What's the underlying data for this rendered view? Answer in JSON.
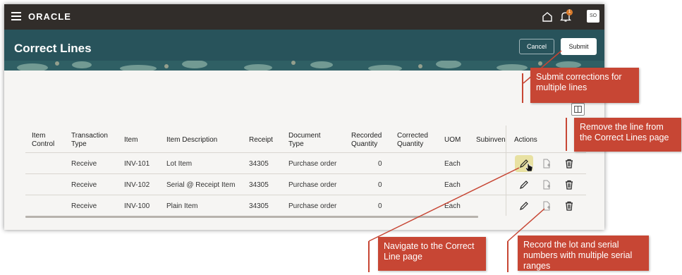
{
  "app": {
    "brand": "ORACLE",
    "notification_count": "1",
    "user_initials": "SO"
  },
  "header": {
    "title": "Correct Lines",
    "cancel_label": "Cancel",
    "submit_label": "Submit"
  },
  "table": {
    "columns": [
      "Item Control",
      "Transaction Type",
      "Item",
      "Item Description",
      "Receipt",
      "Document Type",
      "Recorded Quantity",
      "Corrected Quantity",
      "UOM",
      "Subinven",
      "Actions"
    ],
    "rows": [
      {
        "item_control": "",
        "transaction_type": "Receive",
        "item": "INV-101",
        "item_description": "Lot Item",
        "receipt": "34305",
        "document_type": "Purchase order",
        "recorded_quantity": "0",
        "corrected_quantity": "",
        "uom": "Each",
        "subinventory": ""
      },
      {
        "item_control": "",
        "transaction_type": "Receive",
        "item": "INV-102",
        "item_description": "Serial @ Receipt Item",
        "receipt": "34305",
        "document_type": "Purchase order",
        "recorded_quantity": "0",
        "corrected_quantity": "",
        "uom": "Each",
        "subinventory": ""
      },
      {
        "item_control": "",
        "transaction_type": "Receive",
        "item": "INV-100",
        "item_description": "Plain Item",
        "receipt": "34305",
        "document_type": "Purchase order",
        "recorded_quantity": "0",
        "corrected_quantity": "",
        "uom": "Each",
        "subinventory": ""
      }
    ],
    "action_icons": [
      "pencil-icon",
      "document-plus-icon",
      "trash-icon"
    ]
  },
  "callouts": {
    "submit": "Submit corrections for multiple lines",
    "remove": "Remove the line from the Correct Lines page",
    "navigate": "Navigate to the Correct Line page",
    "record": "Record the lot and serial numbers with multiple serial ranges"
  },
  "colors": {
    "topbar": "#312d2a",
    "header": "#28535b",
    "callout": "#c74634"
  }
}
